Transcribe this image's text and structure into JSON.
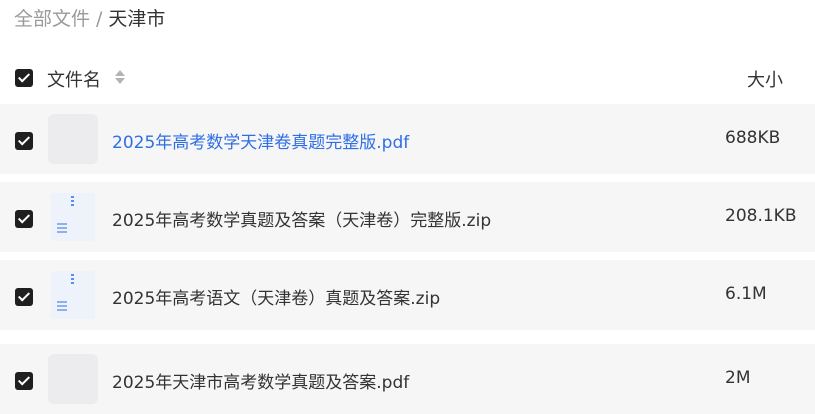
{
  "breadcrumb": {
    "root": "全部文件",
    "separator": "/",
    "current": "天津市"
  },
  "table": {
    "header": {
      "name_label": "文件名",
      "size_label": "大小"
    },
    "rows": [
      {
        "name": "2025年高考数学天津卷真题完整版.pdf",
        "size": "688KB",
        "type": "pdf"
      },
      {
        "name": "2025年高考数学真题及答案（天津卷）完整版.zip",
        "size": "208.1KB",
        "type": "zip"
      },
      {
        "name": "2025年高考语文（天津卷）真题及答案.zip",
        "size": "6.1M",
        "type": "zip"
      },
      {
        "name": "2025年天津市高考数学真题及答案.pdf",
        "size": "2M",
        "type": "pdf"
      }
    ]
  },
  "icons": {
    "sort": "sort-icon",
    "checkbox": "checkbox-checked-icon",
    "zip": "zip-file-icon",
    "pdf": "pdf-thumbnail-placeholder"
  },
  "colors": {
    "link": "#2f6fe6",
    "row_background": "#f6f6f7",
    "checkbox": "#1f1f1f",
    "zip_icon": "#5b8def"
  }
}
